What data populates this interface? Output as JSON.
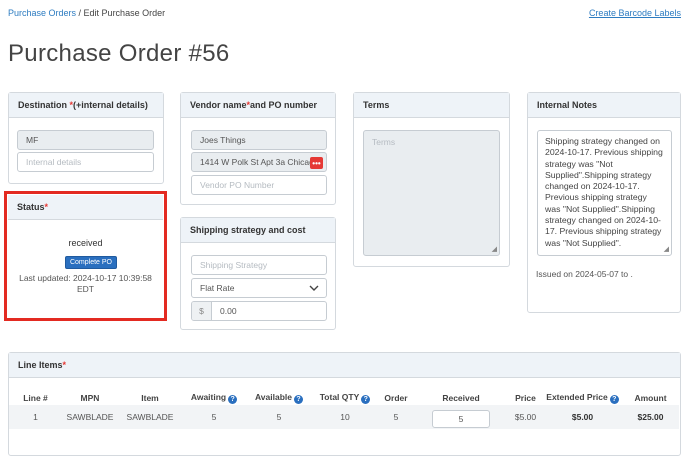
{
  "breadcrumb": {
    "link": "Purchase Orders",
    "separator": " / ",
    "current": "Edit Purchase Order"
  },
  "barcode_link": "Create Barcode Labels",
  "page_title": "Purchase Order #56",
  "destination": {
    "header": "Destination",
    "required_mark": "*",
    "header_suffix": " (+internal details)",
    "value": "MF",
    "internal_placeholder": "Internal details"
  },
  "vendor": {
    "header_a": "Vendor name",
    "required_mark": "*",
    "header_b": " and PO number",
    "name": "Joes Things",
    "address": "1414 W Polk St Apt 3a Chicago",
    "ellipsis": "•••",
    "po_placeholder": "Vendor PO Number"
  },
  "terms": {
    "header": "Terms",
    "placeholder": "Terms"
  },
  "notes": {
    "header": "Internal Notes",
    "text": "Shipping strategy changed on 2024-10-17. Previous shipping strategy was \"Not Supplied\".Shipping strategy changed on 2024-10-17. Previous shipping strategy was \"Not Supplied\".Shipping strategy changed on 2024-10-17. Previous shipping strategy was \"Not Supplied\".",
    "issued": "Issued on 2024-05-07 to ."
  },
  "status": {
    "header": "Status",
    "required_mark": "*",
    "value": "received",
    "button": "Complete PO",
    "last_updated": "Last updated: 2024-10-17 10:39:58 EDT"
  },
  "shipping": {
    "header": "Shipping strategy and cost",
    "strategy_placeholder": "Shipping Strategy",
    "method": "Flat Rate",
    "currency": "$",
    "cost": "0.00"
  },
  "line_items": {
    "header": "Line Items",
    "required_mark": "*",
    "columns": [
      "Line #",
      "MPN",
      "Item",
      "Awaiting",
      "Available",
      "Total QTY",
      "Order",
      "Received",
      "Price",
      "Extended Price",
      "Amount"
    ],
    "help": "?",
    "rows": [
      {
        "line": "1",
        "mpn": "SAWBLADE",
        "item": "SAWBLADE",
        "awaiting": "5",
        "available": "5",
        "total_qty": "10",
        "order": "5",
        "received": "5",
        "price": "$5.00",
        "extended_price": "$5.00",
        "amount": "$25.00"
      }
    ]
  },
  "icons": {
    "select": "chevron-down-icon",
    "help": "help-circle-icon",
    "resize": "resize-handle-icon",
    "more": "ellipsis-icon"
  },
  "colors": {
    "link": "#2d7cc1",
    "primary": "#2a6fbf",
    "required": "#e53935",
    "highlight": "#e32a21",
    "header_bg": "#eef3f8"
  }
}
